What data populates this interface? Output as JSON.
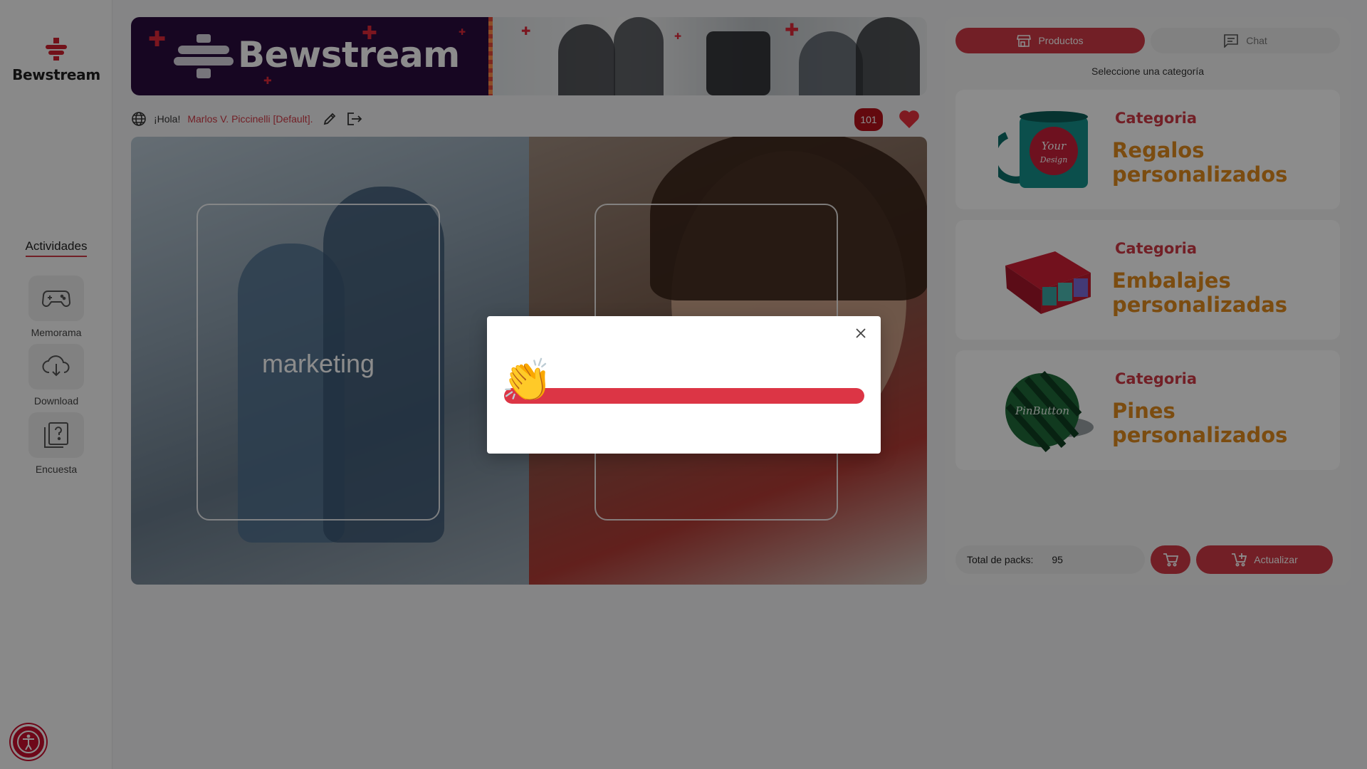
{
  "brand": {
    "name": "Bewstream",
    "accent": "#d03a45",
    "orange": "#e08a1e"
  },
  "banner": {
    "title": "Bewstream"
  },
  "sidebar": {
    "section_title": "Actividades",
    "items": [
      {
        "label": "Memorama",
        "icon": "gamepad-icon"
      },
      {
        "label": "Download",
        "icon": "cloud-download-icon"
      },
      {
        "label": "Encuesta",
        "icon": "question-icon"
      }
    ]
  },
  "userbar": {
    "greeting": "¡Hola!",
    "user": "Marlos V. Piccinelli [Default].",
    "count": "101"
  },
  "stage": {
    "left_label": "marketing"
  },
  "panel": {
    "tabs": [
      {
        "label": "Productos",
        "active": true
      },
      {
        "label": "Chat",
        "active": false
      }
    ],
    "category_prompt": "Seleccione una categoría",
    "cards": [
      {
        "kicker": "Categoria",
        "title": "Regalos personalizados"
      },
      {
        "kicker": "Categoria",
        "title": "Embalajes personalizadas"
      },
      {
        "kicker": "Categoria",
        "title": "Pines personalizados"
      }
    ],
    "footer": {
      "packs_label": "Total de packs:",
      "packs_value": "95",
      "update_label": "Actualizar"
    }
  },
  "modal": {
    "emoji": "👏",
    "progress": 1.0
  }
}
